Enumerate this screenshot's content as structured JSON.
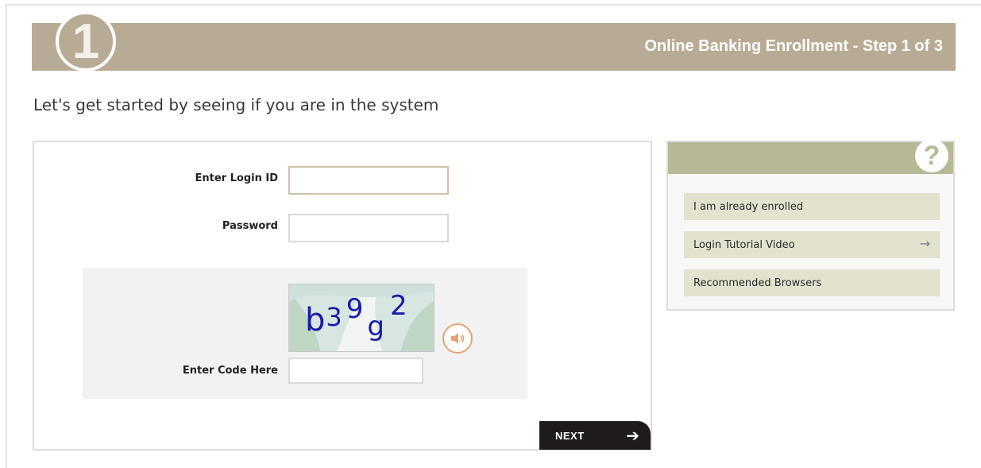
{
  "banner": {
    "step_number": "1",
    "title": "Online Banking Enrollment - Step 1 of 3"
  },
  "heading": "Let's get started by seeing if you are in the system",
  "form": {
    "login_id_label": "Enter Login ID",
    "login_id_value": "",
    "password_label": "Password",
    "password_value": "",
    "captcha": {
      "chars": [
        "b",
        "3",
        "9",
        "g",
        "2"
      ],
      "code_label": "Enter Code Here",
      "code_value": "",
      "audio_icon": "speaker-icon"
    },
    "next_label": "NEXT",
    "next_icon": "arrow-right-icon"
  },
  "help": {
    "icon": "question-icon",
    "links": [
      {
        "label": "I am already enrolled"
      },
      {
        "label": "Login Tutorial Video",
        "icon": "arrow-right-icon"
      },
      {
        "label": "Recommended Browsers"
      }
    ]
  },
  "colors": {
    "banner": "#b8ab95",
    "help_header": "#b7b996",
    "help_link_bg": "#e2e2cf",
    "next_button": "#1f1b1b",
    "captcha_text": "#1a1aa8",
    "audio_accent": "#e8a272"
  }
}
